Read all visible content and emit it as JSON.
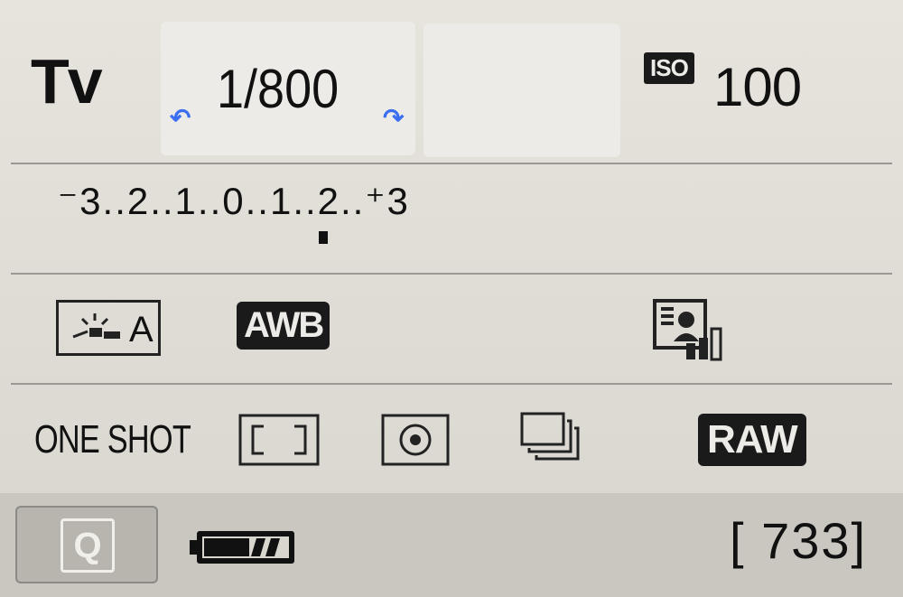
{
  "mode": "Tv",
  "shutter": {
    "value": "1/800",
    "dial_left": "↶",
    "dial_right": "↷"
  },
  "iso": {
    "label": "ISO",
    "value": "100"
  },
  "exposure_scale": {
    "text": "⁻3..2..1..0..1..2..⁺3"
  },
  "settings": {
    "auto_lighting_label": "A",
    "white_balance": "AWB",
    "af_mode": "ONE SHOT",
    "quality": "RAW"
  },
  "bottom": {
    "q_label": "Q",
    "shots_remaining": "[ 733]"
  },
  "colors": {
    "accent_blue": "#3b6ef0",
    "badge_bg": "#1a1a1a"
  },
  "icons": [
    "auto-lighting-optimizer-icon",
    "picture-style-icon",
    "af-area-icon",
    "metering-icon",
    "continuous-drive-icon",
    "battery-icon"
  ]
}
